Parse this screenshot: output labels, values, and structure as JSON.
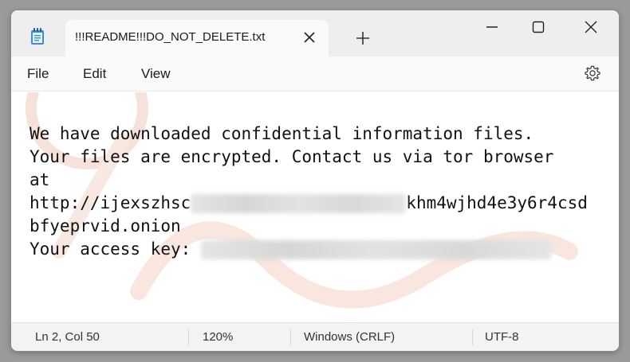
{
  "tab": {
    "title": "!!!README!!!DO_NOT_DELETE.txt"
  },
  "icons": {
    "app": "notepad-icon",
    "close_tab": "close-icon",
    "new_tab": "plus-icon",
    "minimize": "minimize-icon",
    "maximize": "maximize-icon",
    "close_window": "close-icon",
    "settings": "gear-icon"
  },
  "menu": {
    "file": "File",
    "edit": "Edit",
    "view": "View"
  },
  "content": {
    "line1": "We have downloaded confidential information files.",
    "line2": "Your files are encrypted. Contact us via tor browser",
    "line3": "at",
    "line4_prefix": "http://ijexszhsc",
    "line4_suffix": "khm4wjhd4e3y6r4csd",
    "line5": "bfyeprvid.onion",
    "line6": "Your access key: "
  },
  "status": {
    "position": "Ln 2, Col 50",
    "zoom": "120%",
    "line_ending": "Windows (CRLF)",
    "encoding": "UTF-8"
  },
  "colors": {
    "watermark": "#f4d6cc",
    "titlebar": "#eeeeee"
  }
}
